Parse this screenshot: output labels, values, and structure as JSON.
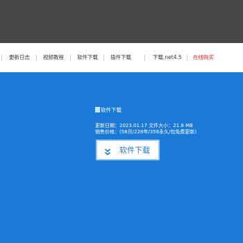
{
  "nav": {
    "items": [
      "更新日志",
      "视频教程",
      "软件下载",
      "插件下载",
      "下载.net4.5",
      "在线购买"
    ]
  },
  "product": {
    "image_alt": "软件下载",
    "update_line": "更新日期：2023.01.17  文件大小：21.8 MB",
    "price_line": "销售价格：(58月/228年/358永久/包免费更新)",
    "download_button": "软件下载"
  },
  "colors": {
    "topbar": "#474747",
    "hero": "#1b7ad8",
    "buy_link": "#e02020"
  },
  "icons": {
    "download_button": "double-chevron-down-icon"
  }
}
